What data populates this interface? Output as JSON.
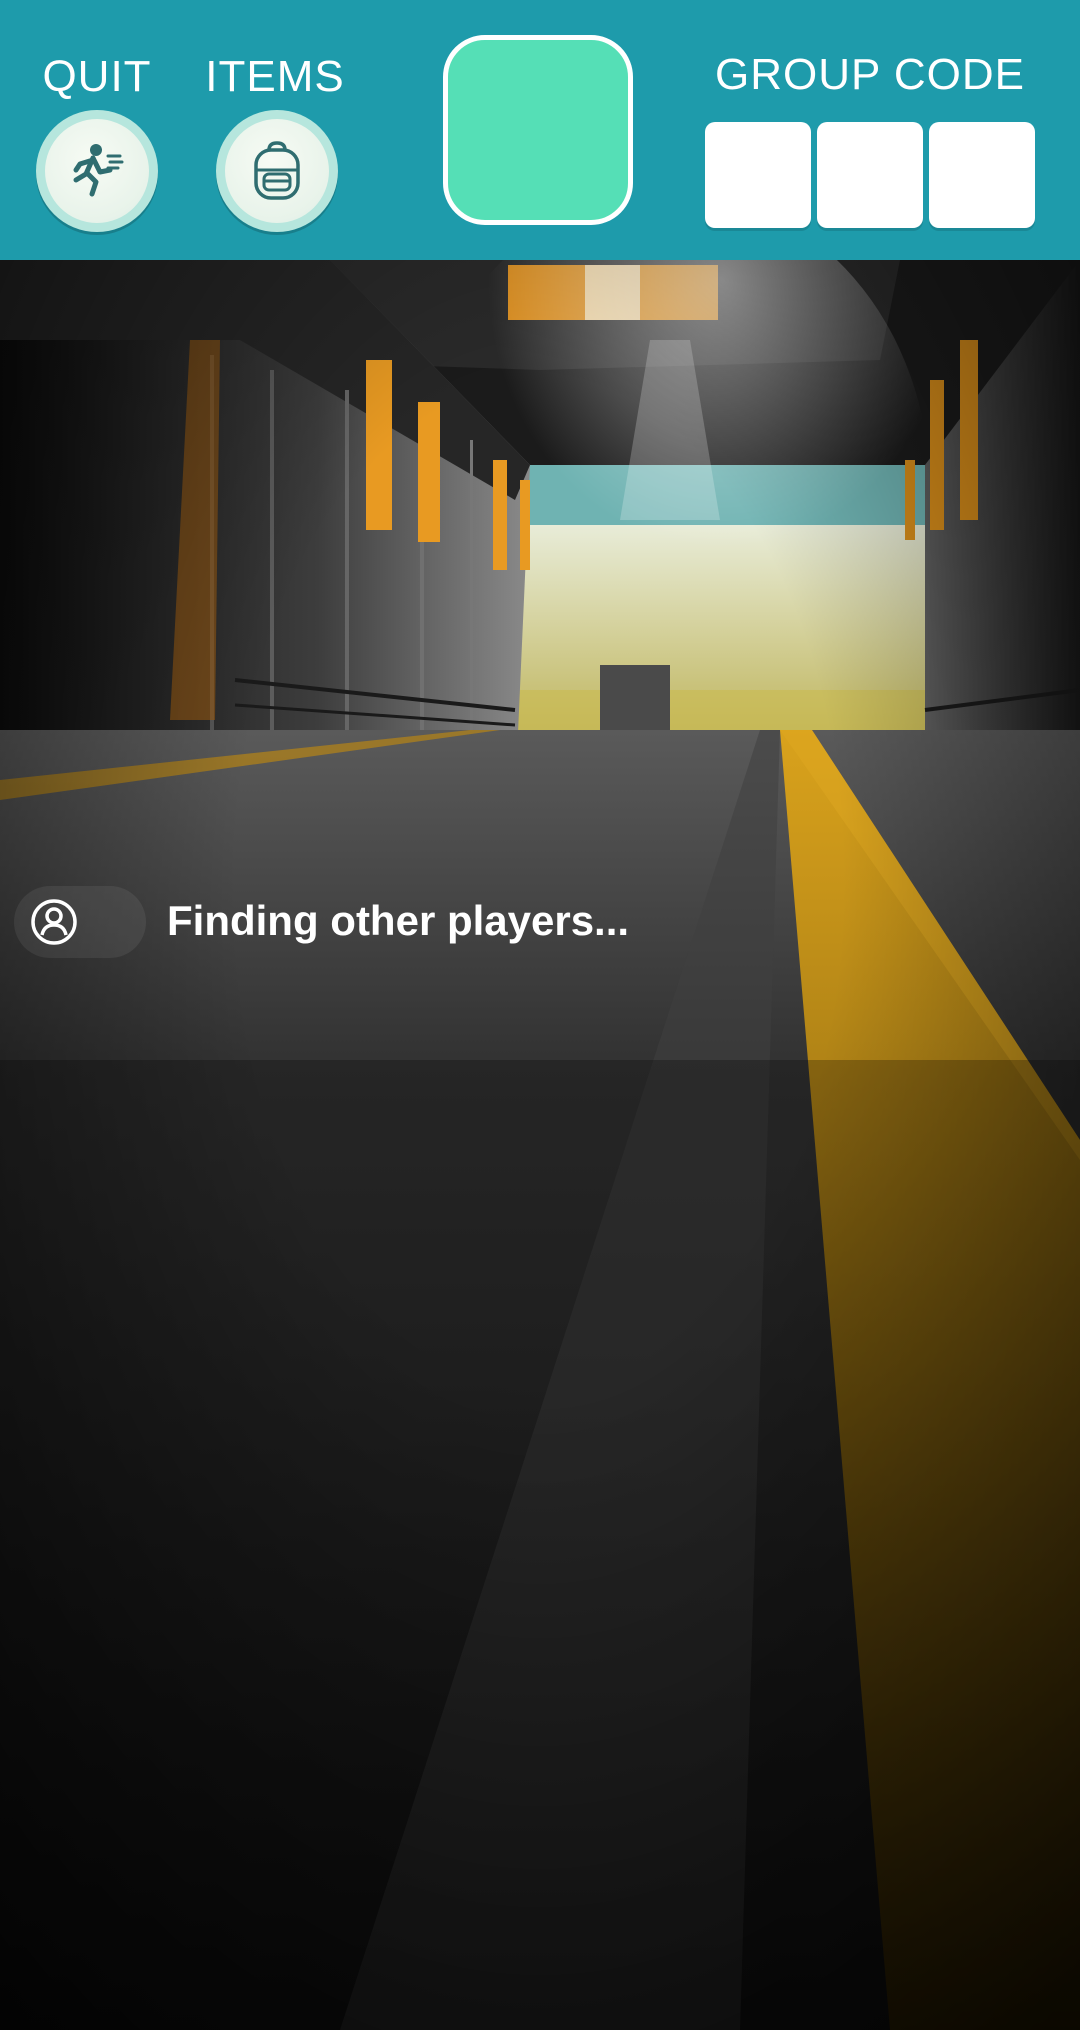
{
  "topbar": {
    "quit_label": "QUIT",
    "items_label": "ITEMS",
    "group_code_label": "GROUP CODE",
    "group_code_slots": [
      "",
      "",
      ""
    ],
    "accent_color": "#1e9bab",
    "tile_color": "#55dfb6"
  },
  "icons": {
    "quit": "running-person-icon",
    "items": "backpack-icon",
    "status": "user-avatar-icon"
  },
  "status": {
    "message": "Finding other players..."
  }
}
